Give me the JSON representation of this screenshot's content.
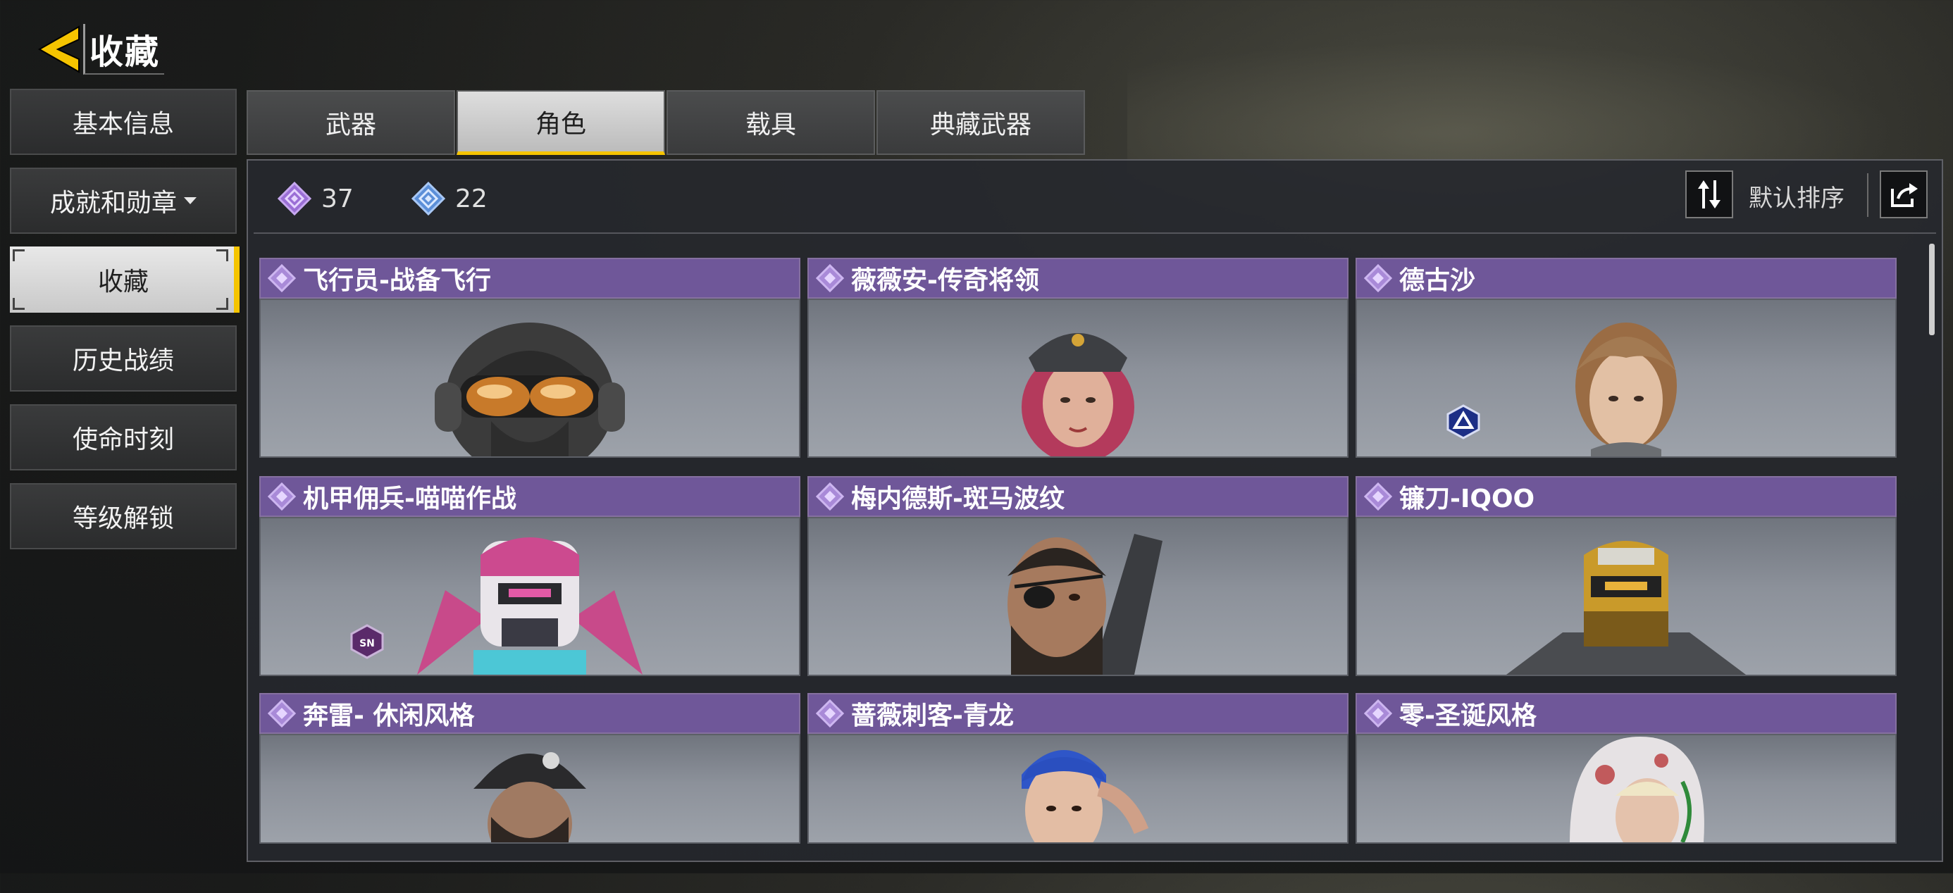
{
  "header": {
    "title": "收藏",
    "back_icon": "back-arrow-icon"
  },
  "colors": {
    "accent": "#f5c400",
    "card_header": "#6f5799",
    "gem_purple": "#9b6fd6",
    "gem_blue": "#5c8fd8"
  },
  "sidebar": {
    "items": [
      {
        "label": "基本信息",
        "active": false
      },
      {
        "label": "成就和勋章",
        "active": false,
        "dropdown": true
      },
      {
        "label": "收藏",
        "active": true
      },
      {
        "label": "历史战绩",
        "active": false
      },
      {
        "label": "使命时刻",
        "active": false
      },
      {
        "label": "等级解锁",
        "active": false
      }
    ]
  },
  "tabs": [
    {
      "label": "武器",
      "active": false
    },
    {
      "label": "角色",
      "active": true
    },
    {
      "label": "载具",
      "active": false
    },
    {
      "label": "典藏武器",
      "active": false
    }
  ],
  "stats": {
    "epic_count": "37",
    "rare_count": "22"
  },
  "toolbar": {
    "sort_label": "默认排序",
    "sort_icon": "sort-arrows-icon",
    "share_icon": "share-icon"
  },
  "cards": [
    {
      "name": "飞行员-战备飞行"
    },
    {
      "name": "薇薇安-传奇将领"
    },
    {
      "name": "德古沙"
    },
    {
      "name": "机甲佣兵-喵喵作战"
    },
    {
      "name": "梅内德斯-斑马波纹"
    },
    {
      "name": "镰刀-IQOO"
    },
    {
      "name": "奔雷- 休闲风格"
    },
    {
      "name": "蔷薇刺客-青龙"
    },
    {
      "name": "零-圣诞风格"
    }
  ]
}
